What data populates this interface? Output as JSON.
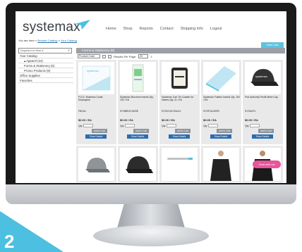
{
  "site": {
    "logo": "systemax",
    "nav": [
      "Home",
      "Shop",
      "Reports",
      "Contact",
      "Shipping Info",
      "Logout"
    ],
    "breadcrumb_prefix": "You are here »",
    "breadcrumb_links": [
      "Browse Catalog",
      "Your Catalog"
    ],
    "breadcrumb_sep": "»",
    "view_cart": "View Cart"
  },
  "sidebar": {
    "search_placeholder": "Keyword or Item #",
    "items": [
      {
        "label": "Your Catalog",
        "level": 0
      },
      {
        "label": "▴ Apparel (34)",
        "level": 1
      },
      {
        "label": "Forms & Stationery (6)",
        "level": 1
      },
      {
        "label": "Promo Products (9)",
        "level": 1
      },
      {
        "label": "Office Supplies",
        "level": 0
      },
      {
        "label": "Favorites",
        "level": 0
      }
    ]
  },
  "content": {
    "category_title": "Forms & Stationery (6)",
    "sort_value": "Product Code",
    "results_label": "Results Per Page:",
    "results_value": "20",
    "pager": "1"
  },
  "products": [
    {
      "name": "P.O.D. Business Cards Employees",
      "sku": "FBCA1",
      "price": "$0.00 / EA",
      "qty_label": "Qty",
      "add": "Add to Cart",
      "show": "Show Details",
      "img": "card"
    },
    {
      "name": "Systemax Brochure Inserts Qty. 100 / EA",
      "sku": "SYSBROCHURE",
      "price": "$0.00 / EA",
      "qty_label": "Qty",
      "add": "Add to Cart",
      "show": "Show Details",
      "img": "brochure"
    },
    {
      "name": "Systemax Cart Tin Coaster for Inserts Qty. 11 / EA",
      "sku": "SYSCOOLTINLK1",
      "price": "$0.00 / EA",
      "qty_label": "Qty",
      "add": "Add to Cart",
      "show": "Show Details",
      "img": "tin"
    },
    {
      "name": "Systemax Folders Inserts Qty. 100 / EA",
      "sku": "SYSFOLDERS",
      "price": "$0.00 / EA",
      "qty_label": "Qty",
      "add": "Add to Cart",
      "show": "Show Details",
      "img": "folder"
    },
    {
      "name": "Port Authority Flexfit Mesh Cap",
      "sku": "SYSHAT1",
      "price": "$0.00 / EA",
      "qty_label": "Qty",
      "add": "Add to Cart",
      "show": "Show Details",
      "img": "cap"
    }
  ],
  "chat_label": "Chat with us!",
  "corner_number": "2",
  "colors": {
    "accent": "#5ec3de",
    "button_blue": "#2b6cb0",
    "bar_gray": "#9aa0a6",
    "chat_pink": "#e8559a"
  }
}
